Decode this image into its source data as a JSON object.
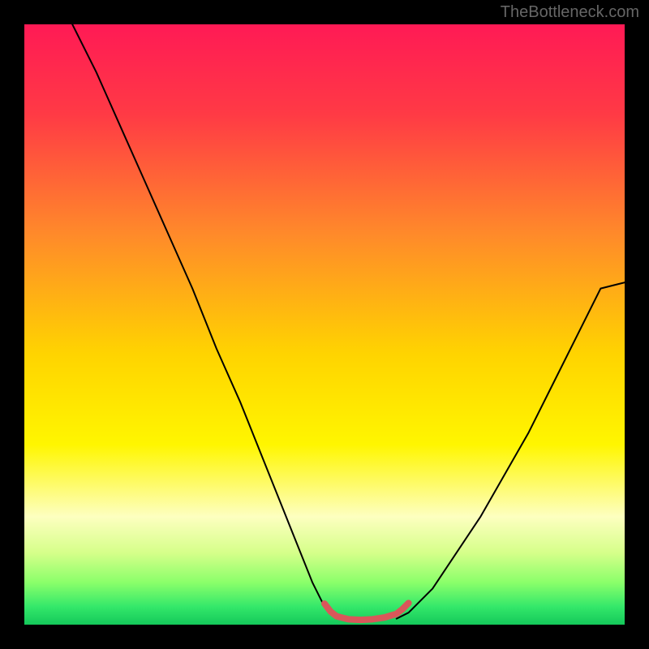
{
  "watermark": "TheBottleneck.com",
  "chart_data": {
    "type": "line",
    "title": "",
    "xlabel": "",
    "ylabel": "",
    "xlim": [
      0,
      100
    ],
    "ylim": [
      0,
      100
    ],
    "background_gradient": {
      "stops": [
        {
          "offset": 0,
          "color": "#ff1a55"
        },
        {
          "offset": 0.15,
          "color": "#ff3a45"
        },
        {
          "offset": 0.35,
          "color": "#ff8a2a"
        },
        {
          "offset": 0.55,
          "color": "#ffd400"
        },
        {
          "offset": 0.7,
          "color": "#fff600"
        },
        {
          "offset": 0.82,
          "color": "#fdffc0"
        },
        {
          "offset": 0.88,
          "color": "#d6ff8a"
        },
        {
          "offset": 0.93,
          "color": "#8aff6a"
        },
        {
          "offset": 0.97,
          "color": "#34e86a"
        },
        {
          "offset": 1.0,
          "color": "#14c85a"
        }
      ]
    },
    "series": [
      {
        "name": "left-curve",
        "type": "line",
        "color": "#000000",
        "width": 2,
        "x": [
          8,
          12,
          16,
          20,
          24,
          28,
          32,
          36,
          40,
          44,
          48,
          50,
          52
        ],
        "y": [
          100,
          92,
          83,
          74,
          65,
          56,
          46,
          37,
          27,
          17,
          7,
          3,
          1
        ]
      },
      {
        "name": "right-curve",
        "type": "line",
        "color": "#000000",
        "width": 2,
        "x": [
          62,
          64,
          68,
          72,
          76,
          80,
          84,
          88,
          92,
          96,
          100
        ],
        "y": [
          1,
          2,
          6,
          12,
          18,
          25,
          32,
          40,
          48,
          56,
          57
        ]
      },
      {
        "name": "valley-band",
        "type": "line",
        "color": "#d9575a",
        "width": 8,
        "x": [
          50,
          51,
          52,
          54,
          56,
          58,
          60,
          62,
          63,
          64
        ],
        "y": [
          3.5,
          2.2,
          1.4,
          0.9,
          0.8,
          0.9,
          1.2,
          1.8,
          2.6,
          3.6
        ]
      }
    ]
  }
}
